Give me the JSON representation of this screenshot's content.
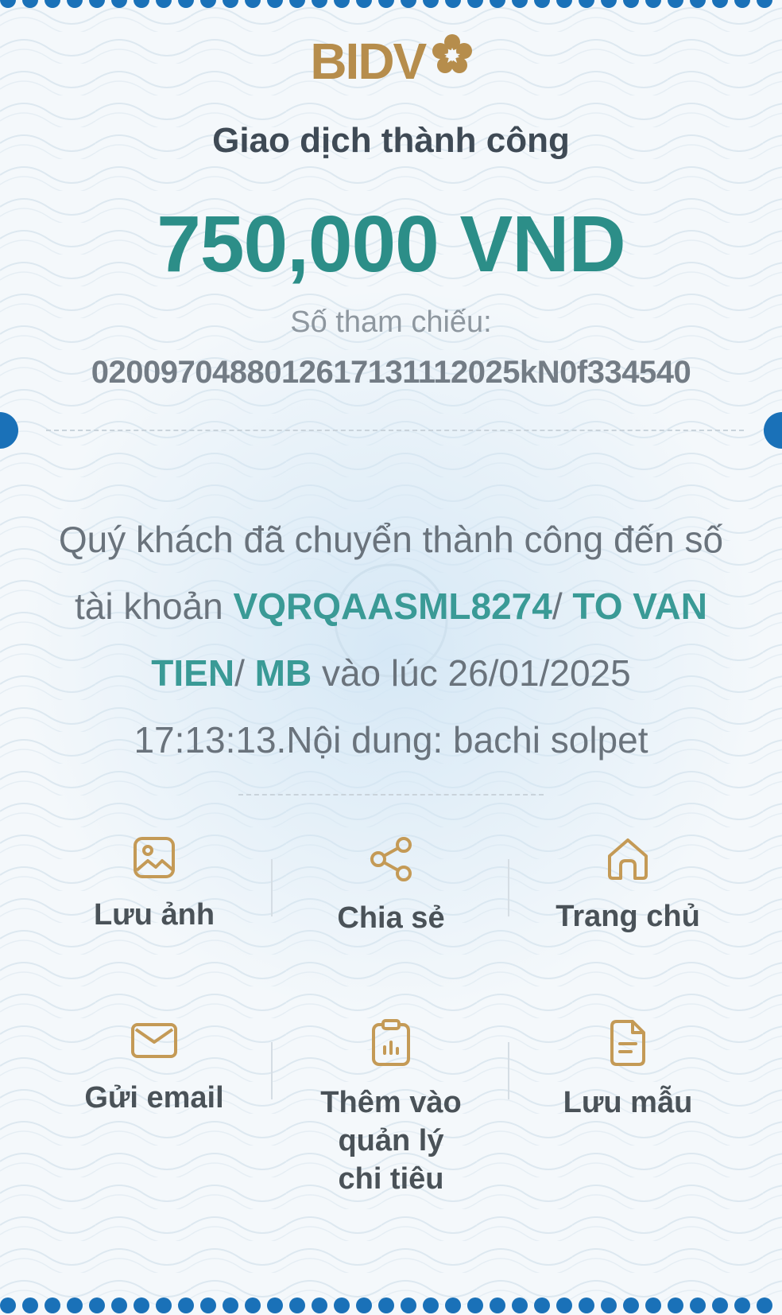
{
  "brand": {
    "name": "BIDV"
  },
  "receipt": {
    "status": "Giao dịch thành công",
    "amount": "750,000 VND",
    "reference_label": "Số tham chiếu:",
    "reference_number": "0200970488012617131112025kN0f334540",
    "message": {
      "intro": "Quý khách đã chuyển thành công đến số tài khoản ",
      "account_number": "VQRQAASML8274",
      "sep1": "/ ",
      "account_name": "TO VAN TIEN",
      "sep2": "/ ",
      "bank": "MB",
      "time_text": " vào lúc 26/01/2025 17:13:13.Nội dung: bachi solpet"
    }
  },
  "actions": [
    {
      "label": "Lưu ảnh",
      "icon": "image-icon"
    },
    {
      "label": "Chia sẻ",
      "icon": "share-icon"
    },
    {
      "label": "Trang chủ",
      "icon": "home-icon"
    },
    {
      "label": "Gửi email",
      "icon": "mail-icon"
    },
    {
      "label": "Thêm vào\nquản lý\nchi tiêu",
      "icon": "clipboard-chart-icon"
    },
    {
      "label": "Lưu mẫu",
      "icon": "document-icon"
    }
  ],
  "colors": {
    "accent_teal": "#2c8e88",
    "gold": "#b68d4c",
    "edge_blue": "#1a71b8",
    "text_dark": "#3f4a55"
  }
}
